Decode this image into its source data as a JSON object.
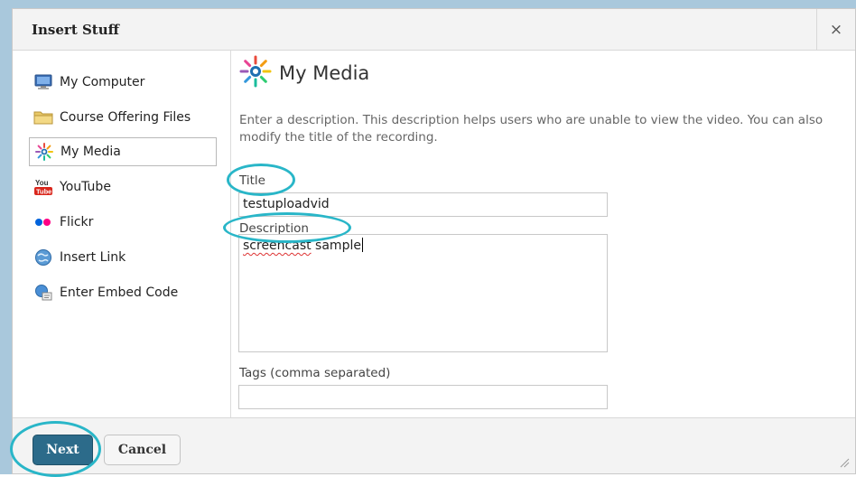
{
  "dialog": {
    "title": "Insert Stuff",
    "close_label": "×"
  },
  "sidebar": {
    "items": [
      {
        "label": "My Computer",
        "icon": "monitor-icon"
      },
      {
        "label": "Course Offering Files",
        "icon": "folder-icon"
      },
      {
        "label": "My Media",
        "icon": "my-media-icon",
        "selected": true
      },
      {
        "label": "YouTube",
        "icon": "youtube-icon"
      },
      {
        "label": "Flickr",
        "icon": "flickr-icon"
      },
      {
        "label": "Insert Link",
        "icon": "globe-link-icon"
      },
      {
        "label": "Enter Embed Code",
        "icon": "embed-code-icon"
      }
    ]
  },
  "main": {
    "heading": "My Media",
    "description": "Enter a description. This description helps users who are unable to view the video. You can also modify the title of the recording.",
    "title_label": "Title",
    "title_value": "testuploadvid",
    "description_label": "Description",
    "description_value": "screencast sample",
    "description_value_first_word": "screencast",
    "description_value_rest": " sample",
    "tags_label": "Tags (comma separated)",
    "tags_value": ""
  },
  "footer": {
    "next_label": "Next",
    "cancel_label": "Cancel"
  },
  "colors": {
    "next_button": "#2c6b8a",
    "highlight_oval": "#29b6c8"
  }
}
